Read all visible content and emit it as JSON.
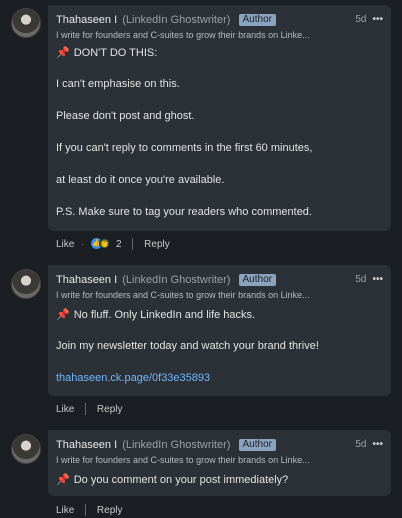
{
  "comments": [
    {
      "author": "Thahaseen I",
      "role": "(LinkedIn Ghostwriter)",
      "badge": "Author",
      "time": "5d",
      "more": "•••",
      "headline": "I write for founders and C-suites to grow their brands on Linke...",
      "body": {
        "title": "DON'T DO THIS:",
        "p1": "I can't emphasise on this.",
        "p2": "Please don't post and ghost.",
        "p3": "If you can't reply to comments in the first 60 minutes,",
        "p4": "at least do it once you're available.",
        "p5": "P.S. Make sure to tag your readers who commented."
      },
      "like": "Like",
      "reaction_count": "2",
      "reply": "Reply"
    },
    {
      "author": "Thahaseen I",
      "role": "(LinkedIn Ghostwriter)",
      "badge": "Author",
      "time": "5d",
      "more": "•••",
      "headline": "I write for founders and C-suites to grow their brands on Linke...",
      "body": {
        "title": "No fluff. Only LinkedIn and life hacks.",
        "p1": "Join my newsletter today and watch your brand thrive!",
        "link": "thahaseen.ck.page/0f33e35893"
      },
      "like": "Like",
      "reply": "Reply"
    },
    {
      "author": "Thahaseen I",
      "role": "(LinkedIn Ghostwriter)",
      "badge": "Author",
      "time": "5d",
      "more": "•••",
      "headline": "I write for founders and C-suites to grow their brands on Linke...",
      "body": {
        "title": "Do you comment on your post immediately?"
      },
      "like": "Like",
      "reply": "Reply"
    }
  ],
  "icons": {
    "pin": "pushpin-icon",
    "more": "more-options-icon",
    "like_reaction": "like-reaction-icon",
    "celebrate_reaction": "celebrate-reaction-icon"
  },
  "colors": {
    "badge": "#8aa4c0",
    "link": "#71b7fb",
    "bubble": "#2c3137",
    "background": "#1b1f23"
  }
}
